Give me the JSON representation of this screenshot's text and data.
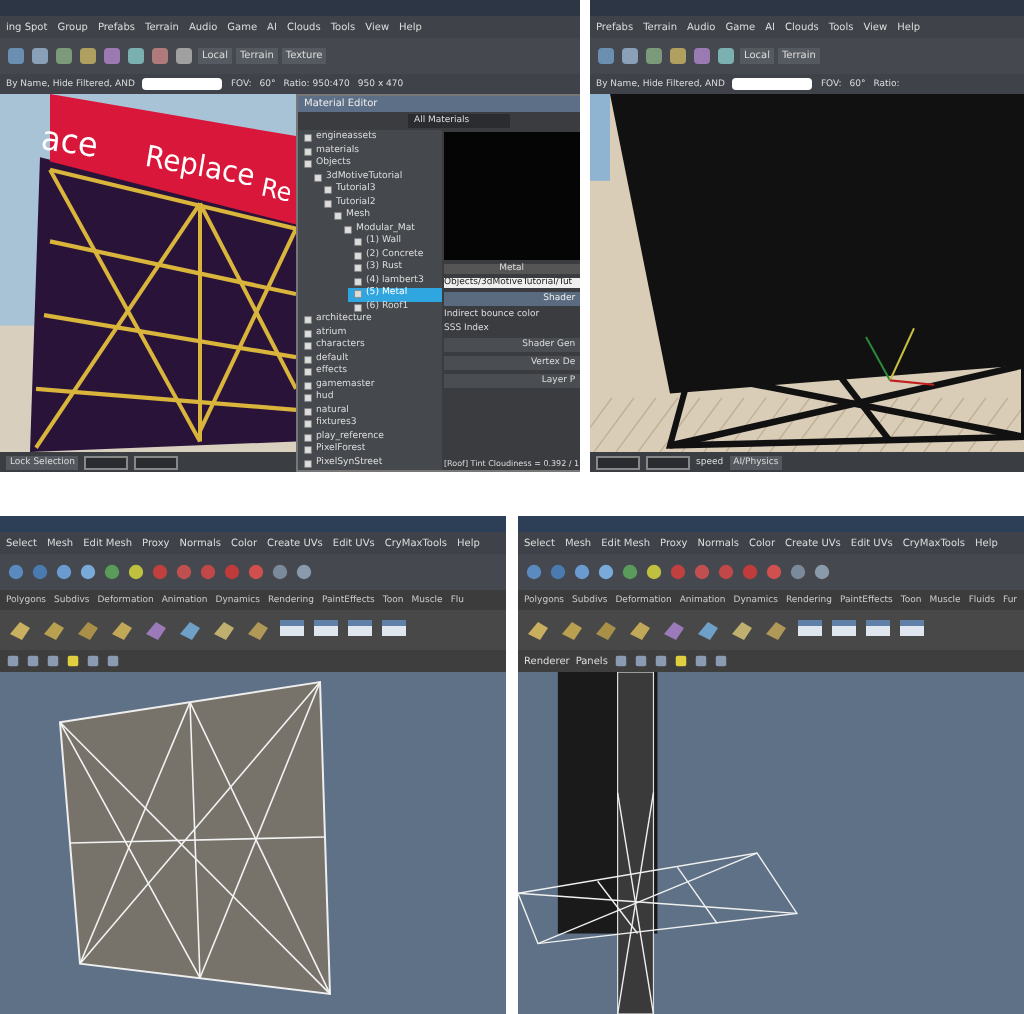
{
  "editor_top_left": {
    "menu": [
      "ing Spot",
      "Group",
      "Prefabs",
      "Terrain",
      "Audio",
      "Game",
      "AI",
      "Clouds",
      "Tools",
      "View",
      "Help"
    ],
    "transform_space": "Local",
    "tool_labels": [
      "Terrain",
      "Texture"
    ],
    "filter": "By Name, Hide Filtered, AND",
    "fov_label": "FOV:",
    "fov": "60°",
    "ratio": "Ratio: 950:470",
    "size": "950 x 470",
    "viewport": {
      "sign_texts": [
        "ace",
        "Replace",
        "Re"
      ]
    },
    "status": {
      "lock_selection": "Lock Selection"
    },
    "material_editor": {
      "title": "Material Editor",
      "filter": "All Materials",
      "tree": [
        {
          "label": "engineassets",
          "selected": false
        },
        {
          "label": "materials",
          "selected": false
        },
        {
          "label": "Objects",
          "selected": false,
          "children": [
            {
              "label": "3dMotiveTutorial",
              "selected": false,
              "children": [
                {
                  "label": "Tutorial3",
                  "selected": false
                },
                {
                  "label": "Tutorial2",
                  "selected": false,
                  "children": [
                    {
                      "label": "Mesh",
                      "selected": false,
                      "children": [
                        {
                          "label": "Modular_Mat",
                          "selected": false,
                          "children": [
                            {
                              "label": "(1) Wall",
                              "selected": false
                            },
                            {
                              "label": "(2) Concrete",
                              "selected": false
                            },
                            {
                              "label": "(3) Rust",
                              "selected": false
                            },
                            {
                              "label": "(4) lambert3",
                              "selected": false
                            },
                            {
                              "label": "(5) Metal",
                              "selected": true
                            },
                            {
                              "label": "(6) Roof1",
                              "selected": false
                            }
                          ]
                        }
                      ]
                    }
                  ]
                }
              ]
            }
          ]
        },
        {
          "label": "architecture",
          "selected": false
        },
        {
          "label": "atrium",
          "selected": false
        },
        {
          "label": "characters",
          "selected": false
        },
        {
          "label": "default",
          "selected": false
        },
        {
          "label": "effects",
          "selected": false
        },
        {
          "label": "gamemaster",
          "selected": false
        },
        {
          "label": "hud",
          "selected": false
        },
        {
          "label": "natural",
          "selected": false
        },
        {
          "label": "fixtures3",
          "selected": false
        },
        {
          "label": "play_reference",
          "selected": false
        },
        {
          "label": "PixelForest",
          "selected": false
        },
        {
          "label": "PixelSynStreet",
          "selected": false
        }
      ],
      "preview_label": "Metal",
      "path": "Objects/3dMotiveTutorial/Tut",
      "shader_button": "Shader",
      "props": [
        "Indirect bounce color",
        "SSS Index"
      ],
      "sections": [
        "Shader Gen",
        "Vertex De",
        "Layer P"
      ],
      "footer": "[Roof] Tint Cloudiness = 0.392 / 1"
    }
  },
  "editor_top_right": {
    "menu": [
      "Prefabs",
      "Terrain",
      "Audio",
      "Game",
      "AI",
      "Clouds",
      "Tools",
      "View",
      "Help"
    ],
    "transform_space": "Local",
    "tool_label": "Terrain",
    "filter": "By Name, Hide Filtered, AND",
    "fov_label": "FOV:",
    "fov": "60°",
    "ratio": "Ratio:",
    "status": {
      "speed_label": "speed",
      "physics_button": "AI/Physics"
    }
  },
  "maya_bottom_left": {
    "menu": [
      "Select",
      "Mesh",
      "Edit Mesh",
      "Proxy",
      "Normals",
      "Color",
      "Create UVs",
      "Edit UVs",
      "CryMaxTools",
      "Help"
    ],
    "shelf_tabs": [
      "Polygons",
      "Subdivs",
      "Deformation",
      "Animation",
      "Dynamics",
      "Rendering",
      "PaintEffects",
      "Toon",
      "Muscle",
      "Flu"
    ]
  },
  "maya_bottom_right": {
    "menu": [
      "Select",
      "Mesh",
      "Edit Mesh",
      "Proxy",
      "Normals",
      "Color",
      "Create UVs",
      "Edit UVs",
      "CryMaxTools",
      "Help"
    ],
    "shelf_tabs": [
      "Polygons",
      "Subdivs",
      "Deformation",
      "Animation",
      "Dynamics",
      "Rendering",
      "PaintEffects",
      "Toon",
      "Muscle",
      "Fluids",
      "Fur"
    ],
    "panel_menu": [
      "Renderer",
      "Panels"
    ]
  }
}
